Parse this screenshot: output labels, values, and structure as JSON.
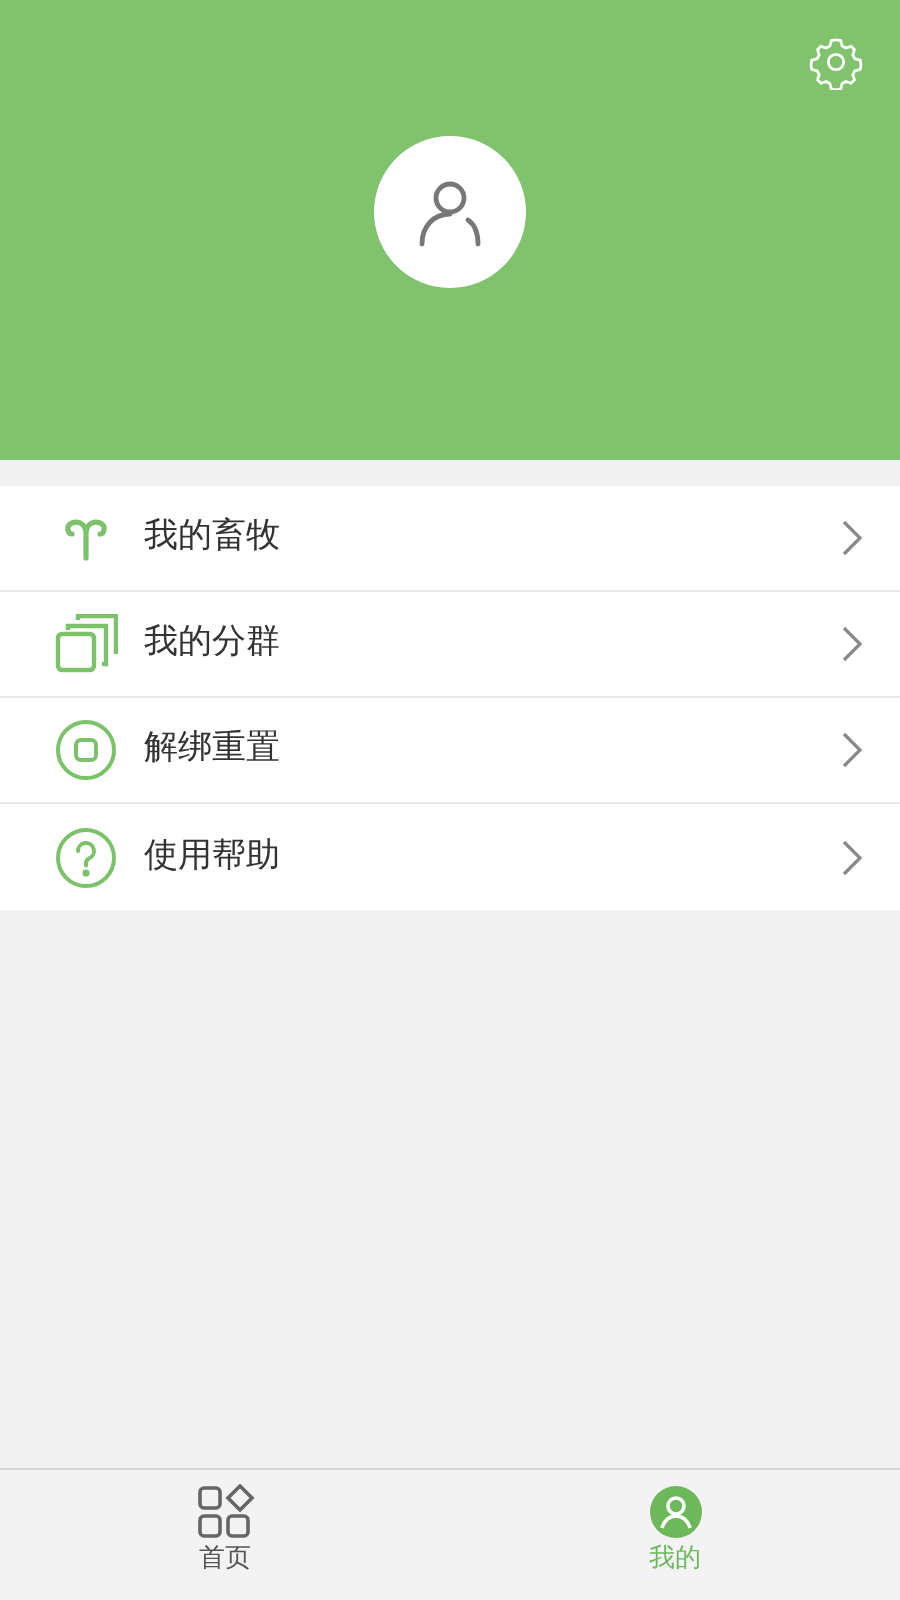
{
  "menu": [
    {
      "kind": "livestock",
      "label": "我的畜牧"
    },
    {
      "kind": "groups",
      "label": "我的分群"
    },
    {
      "kind": "reset",
      "label": "解绑重置"
    },
    {
      "kind": "help",
      "label": "使用帮助"
    }
  ],
  "tabs": [
    {
      "kind": "home",
      "label": "首页",
      "selected": false
    },
    {
      "kind": "mine",
      "label": "我的",
      "selected": true
    }
  ]
}
